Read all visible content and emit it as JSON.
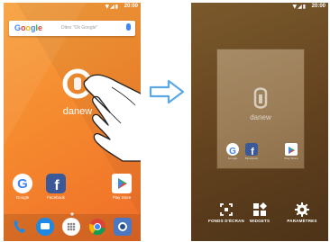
{
  "left_screen": {
    "status": {
      "time": "20:00",
      "icons": "▼◢▮"
    },
    "search": {
      "logo_letters": [
        "G",
        "o",
        "o",
        "g",
        "l",
        "e"
      ],
      "logo_colors": [
        "#4285f4",
        "#ea4335",
        "#fbbc05",
        "#4285f4",
        "#34a853",
        "#ea4335"
      ],
      "hint": "Dites \"Ok Google\""
    },
    "brand_text": "danew",
    "home_apps": [
      {
        "name": "google",
        "label": "Google"
      },
      {
        "name": "facebook",
        "label": "Facebook"
      },
      {
        "name": "play-store",
        "label": "Play Store"
      }
    ],
    "dock_apps": [
      "phone",
      "messages",
      "apps-drawer",
      "chrome",
      "camera"
    ]
  },
  "arrow": {
    "color": "#5aa9e6"
  },
  "right_screen": {
    "status": {
      "time": "20:00",
      "icons": "▼◢▮"
    },
    "preview_brand_text": "danew",
    "preview_apps": [
      {
        "name": "google",
        "label": "Google"
      },
      {
        "name": "facebook",
        "label": "Facebook"
      },
      {
        "name": "play-store",
        "label": "Play Store"
      }
    ],
    "options": [
      {
        "name": "wallpaper",
        "label": "FONDS D'ÉCRAN"
      },
      {
        "name": "widgets",
        "label": "WIDGETS"
      },
      {
        "name": "settings",
        "label": "PARAMÈTRES"
      }
    ]
  }
}
